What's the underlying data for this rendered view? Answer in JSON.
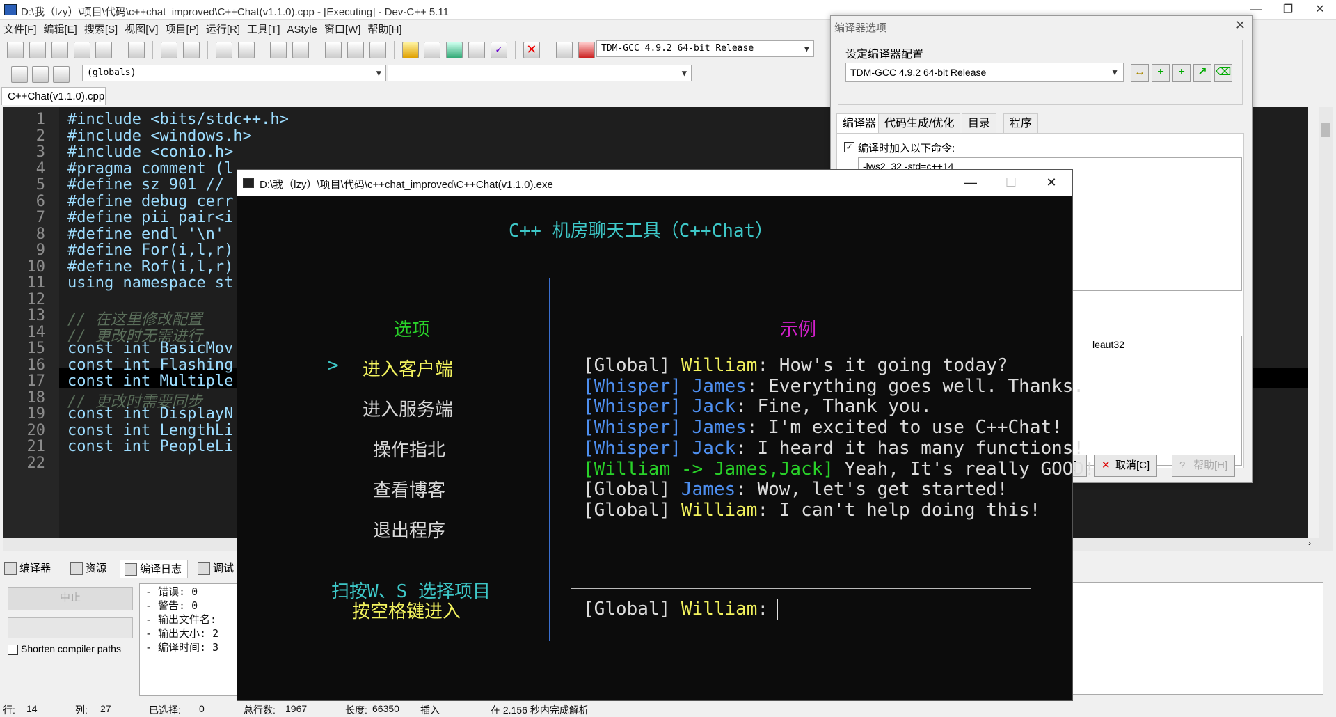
{
  "ide": {
    "title": "D:\\我（lzy）\\项目\\代码\\c++chat_improved\\C++Chat(v1.1.0).cpp - [Executing] - Dev-C++ 5.11",
    "menu": [
      "文件[F]",
      "编辑[E]",
      "搜索[S]",
      "视图[V]",
      "项目[P]",
      "运行[R]",
      "工具[T]",
      "AStyle",
      "窗口[W]",
      "帮助[H]"
    ],
    "compiler_select": "TDM-GCC 4.9.2 64-bit Release",
    "scope_select": "(globals)",
    "file_tab": "C++Chat(v1.1.0).cpp",
    "code_lines": [
      {
        "n": "1",
        "text": "#include <bits/stdc++.h>"
      },
      {
        "n": "2",
        "text": "#include <windows.h>"
      },
      {
        "n": "3",
        "text": "#include <conio.h>"
      },
      {
        "n": "4",
        "text": "#pragma comment (l"
      },
      {
        "n": "5",
        "text": "#define sz 901 //"
      },
      {
        "n": "6",
        "text": "#define debug cerr"
      },
      {
        "n": "7",
        "text": "#define pii pair<i"
      },
      {
        "n": "8",
        "text": "#define endl '\\n'"
      },
      {
        "n": "9",
        "text": "#define For(i,l,r)"
      },
      {
        "n": "10",
        "text": "#define Rof(i,l,r)"
      },
      {
        "n": "11",
        "text": "using namespace st"
      },
      {
        "n": "12",
        "text": ""
      },
      {
        "n": "13",
        "text": "// 在这里修改配置"
      },
      {
        "n": "14",
        "text": "// 更改时无需进行"
      },
      {
        "n": "15",
        "text": "const int BasicMov"
      },
      {
        "n": "16",
        "text": "const int Flashing"
      },
      {
        "n": "17",
        "text": "const int Multiple"
      },
      {
        "n": "18",
        "text": "// 更改时需要同步"
      },
      {
        "n": "19",
        "text": "const int DisplayN"
      },
      {
        "n": "20",
        "text": "const int LengthLi"
      },
      {
        "n": "21",
        "text": "const int PeopleLi"
      },
      {
        "n": "22",
        "text": ""
      }
    ],
    "panel_tabs": [
      "编译器",
      "资源",
      "编译日志",
      "调试"
    ],
    "abort_button": "中止",
    "shorten_label": "Shorten compiler paths",
    "log_lines": [
      "- 错误: 0",
      "- 警告: 0",
      "- 输出文件名:",
      "- 输出大小: 2",
      "- 编译时间: 3"
    ],
    "status": {
      "row_label": "行:",
      "row": "14",
      "col_label": "列:",
      "col": "27",
      "sel_label": "已选择:",
      "sel": "0",
      "total_label": "总行数:",
      "total": "1967",
      "len_label": "长度:",
      "len": "66350",
      "mode": "插入",
      "parse": "在 2.156 秒内完成解析"
    }
  },
  "dialog": {
    "title": "编译器选项",
    "group_label": "设定编译器配置",
    "select": "TDM-GCC 4.9.2 64-bit Release",
    "tabs": [
      "编译器",
      "代码生成/优化",
      "目录",
      "程序"
    ],
    "checkbox_label": "编译时加入以下命令:",
    "cmd_text": "-lws2_32 -std=c++14",
    "linker_text": "leaut32",
    "ok_fragment": "]",
    "cancel": "取消[C]",
    "help": "帮助[H]"
  },
  "console": {
    "title": "D:\\我（lzy）\\项目\\代码\\c++chat_improved\\C++Chat(v1.1.0).exe",
    "app_title": "C++ 机房聊天工具（C++Chat）",
    "options_heading": "选项",
    "selector": ">",
    "options": [
      "进入客户端",
      "进入服务端",
      "操作指北",
      "查看博客",
      "退出程序"
    ],
    "example_heading": "示例",
    "hint1": "扫按W、S 选择项目",
    "hint2": "按空格键进入",
    "chat": [
      [
        {
          "t": "[Global] ",
          "c": "w"
        },
        {
          "t": "William",
          "c": "y"
        },
        {
          "t": ": How's it going today?",
          "c": "w"
        }
      ],
      [
        {
          "t": "[Whisper] ",
          "c": "b"
        },
        {
          "t": "James",
          "c": "b"
        },
        {
          "t": ": Everything goes well. Thanks.",
          "c": "w"
        }
      ],
      [
        {
          "t": "[Whisper] ",
          "c": "b"
        },
        {
          "t": "Jack",
          "c": "b"
        },
        {
          "t": ": Fine, Thank you.",
          "c": "w"
        }
      ],
      [
        {
          "t": "[Whisper] ",
          "c": "b"
        },
        {
          "t": "James",
          "c": "b"
        },
        {
          "t": ": I'm excited to use C++Chat!",
          "c": "w"
        }
      ],
      [
        {
          "t": "[Whisper] ",
          "c": "b"
        },
        {
          "t": "Jack",
          "c": "b"
        },
        {
          "t": ": I heard it has many functions!",
          "c": "w"
        }
      ],
      [
        {
          "t": "[William -> James,Jack]",
          "c": "g"
        },
        {
          "t": " Yeah, It's really GOOD!",
          "c": "w"
        }
      ],
      [
        {
          "t": "[Global] ",
          "c": "w"
        },
        {
          "t": "James",
          "c": "b"
        },
        {
          "t": ": Wow, let's get started!",
          "c": "w"
        }
      ],
      [
        {
          "t": "[Global] ",
          "c": "w"
        },
        {
          "t": "William",
          "c": "y"
        },
        {
          "t": ": I can't help doing this!",
          "c": "w"
        }
      ]
    ],
    "input_prefix": "[Global] ",
    "input_user": "William",
    "input_colon": ": "
  },
  "colors": {
    "accent_blue": "#4e8ff0",
    "yellow": "#f3f35e",
    "green": "#29d129",
    "cyan": "#3ec8c8",
    "magenta": "#d020c8"
  }
}
